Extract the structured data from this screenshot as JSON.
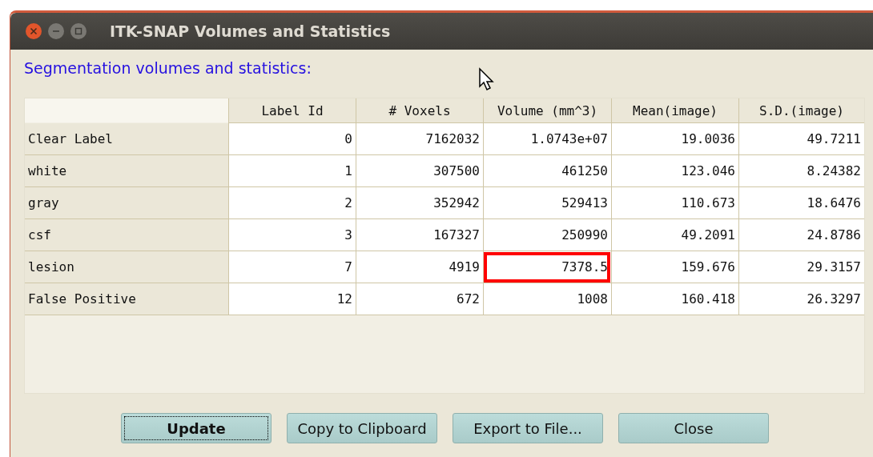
{
  "window": {
    "title": "ITK-SNAP Volumes and Statistics"
  },
  "heading": "Segmentation volumes and statistics:",
  "table": {
    "columns": [
      "Label Id",
      "# Voxels",
      "Volume (mm^3)",
      "Mean(image)",
      "S.D.(image)"
    ],
    "rows": [
      {
        "label": "Clear Label",
        "cells": [
          {
            "value": "0",
            "highlighted": false
          },
          {
            "value": "7162032",
            "highlighted": false
          },
          {
            "value": "1.0743e+07",
            "highlighted": false
          },
          {
            "value": "19.0036",
            "highlighted": false
          },
          {
            "value": "49.7211",
            "highlighted": false
          }
        ]
      },
      {
        "label": "white",
        "cells": [
          {
            "value": "1",
            "highlighted": false
          },
          {
            "value": "307500",
            "highlighted": false
          },
          {
            "value": "461250",
            "highlighted": false
          },
          {
            "value": "123.046",
            "highlighted": false
          },
          {
            "value": "8.24382",
            "highlighted": false
          }
        ]
      },
      {
        "label": "gray",
        "cells": [
          {
            "value": "2",
            "highlighted": false
          },
          {
            "value": "352942",
            "highlighted": false
          },
          {
            "value": "529413",
            "highlighted": false
          },
          {
            "value": "110.673",
            "highlighted": false
          },
          {
            "value": "18.6476",
            "highlighted": false
          }
        ]
      },
      {
        "label": "csf",
        "cells": [
          {
            "value": "3",
            "highlighted": false
          },
          {
            "value": "167327",
            "highlighted": false
          },
          {
            "value": "250990",
            "highlighted": false
          },
          {
            "value": "49.2091",
            "highlighted": false
          },
          {
            "value": "24.8786",
            "highlighted": false
          }
        ]
      },
      {
        "label": "lesion",
        "cells": [
          {
            "value": "7",
            "highlighted": false
          },
          {
            "value": "4919",
            "highlighted": false
          },
          {
            "value": "7378.5",
            "highlighted": true
          },
          {
            "value": "159.676",
            "highlighted": false
          },
          {
            "value": "29.3157",
            "highlighted": false
          }
        ]
      },
      {
        "label": "False Positive",
        "cells": [
          {
            "value": "12",
            "highlighted": false
          },
          {
            "value": "672",
            "highlighted": false
          },
          {
            "value": "1008",
            "highlighted": false
          },
          {
            "value": "160.418",
            "highlighted": false
          },
          {
            "value": "26.3297",
            "highlighted": false
          }
        ]
      }
    ]
  },
  "buttons": [
    {
      "label": "Update",
      "focused": true
    },
    {
      "label": "Copy to Clipboard",
      "focused": false
    },
    {
      "label": "Export to File...",
      "focused": false
    },
    {
      "label": "Close",
      "focused": false
    }
  ]
}
